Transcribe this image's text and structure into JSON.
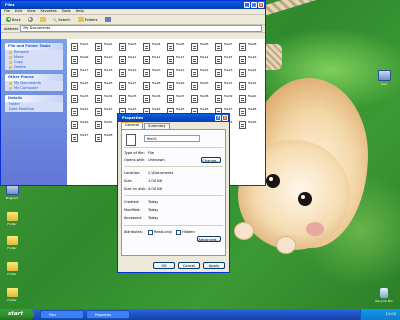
{
  "desktop": {
    "icons_left": [
      {
        "label": "My Documents",
        "kind": "folder"
      },
      {
        "label": "My Computer",
        "kind": "pc"
      },
      {
        "label": "My Network",
        "kind": "pc"
      },
      {
        "label": "Folder",
        "kind": "folder"
      },
      {
        "label": "Folder",
        "kind": "folder"
      },
      {
        "label": "Program",
        "kind": "pc"
      },
      {
        "label": "Folder",
        "kind": "folder"
      },
      {
        "label": "Folder",
        "kind": "folder"
      },
      {
        "label": "Folder",
        "kind": "folder"
      },
      {
        "label": "Folder",
        "kind": "folder"
      }
    ],
    "icons_right": [
      {
        "label": "Icon",
        "kind": "pc"
      },
      {
        "label": "Recycle Bin",
        "kind": "bin"
      }
    ]
  },
  "explorer": {
    "title": "Files",
    "menu": [
      "File",
      "Edit",
      "View",
      "Favorites",
      "Tools",
      "Help"
    ],
    "toolbar": {
      "back": "Back",
      "search": "Search",
      "folders": "Folders"
    },
    "address_label": "Address",
    "address_value": "My Documents",
    "task_pane": [
      {
        "title": "File and Folder Tasks",
        "items": [
          "Rename",
          "Move",
          "Copy",
          "Delete"
        ]
      },
      {
        "title": "Other Places",
        "items": [
          "My Documents",
          "My Computer"
        ]
      },
      {
        "title": "Details",
        "items": [
          "Folder",
          "Date Modified"
        ]
      }
    ],
    "files": [
      "file01",
      "file02",
      "file03",
      "file04",
      "file05",
      "file06",
      "file07",
      "file08",
      "file09",
      "file10",
      "file11",
      "file12",
      "file13",
      "file14",
      "file15",
      "file16",
      "file17",
      "file18",
      "file19",
      "file20",
      "file21",
      "file22",
      "file23",
      "file24",
      "file25",
      "file26",
      "file27",
      "file28",
      "file29",
      "file30",
      "file31",
      "file32",
      "file33",
      "file34",
      "file35",
      "file36",
      "file37",
      "file38",
      "file39",
      "file40",
      "file41",
      "file42",
      "file43",
      "file44",
      "file45",
      "file46",
      "file47",
      "file48",
      "file49",
      "file50",
      "file51",
      "file52",
      "file53",
      "file54",
      "file55",
      "file56",
      "file57",
      "file58",
      "file59",
      "file60"
    ]
  },
  "properties": {
    "title": "Properties",
    "tabs": [
      "General",
      "Summary"
    ],
    "file_name": "file01",
    "rows": [
      {
        "k": "Type of file:",
        "v": "File"
      },
      {
        "k": "Opens with:",
        "v": "Unknown"
      },
      {
        "k": "Location:",
        "v": "C:\\Documents"
      },
      {
        "k": "Size:",
        "v": "1.00 KB"
      },
      {
        "k": "Size on disk:",
        "v": "4.00 KB"
      },
      {
        "k": "Created:",
        "v": "Today"
      },
      {
        "k": "Modified:",
        "v": "Today"
      },
      {
        "k": "Accessed:",
        "v": "Today"
      }
    ],
    "change_label": "Change...",
    "attributes_label": "Attributes:",
    "readonly_label": "Read-only",
    "hidden_label": "Hidden",
    "advanced_label": "Advanced...",
    "ok_label": "OK",
    "cancel_label": "Cancel",
    "apply_label": "Apply"
  },
  "taskbar": {
    "start_label": "start",
    "tasks": [
      "Files",
      "Properties"
    ],
    "clock": "12:00"
  }
}
